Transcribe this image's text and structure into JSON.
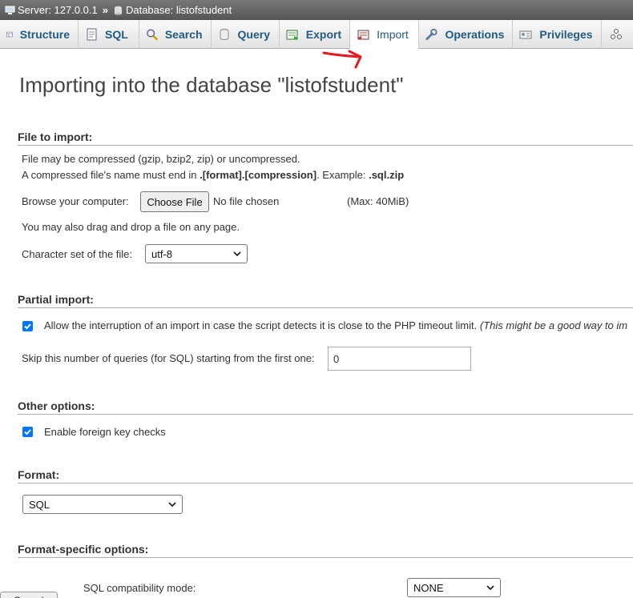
{
  "breadcrumb": {
    "server": "Server: 127.0.0.1",
    "separator": "»",
    "database": "Database: listofstudent"
  },
  "tabs": [
    {
      "label": "Structure",
      "icon": "structure-icon"
    },
    {
      "label": "SQL",
      "icon": "sql-icon"
    },
    {
      "label": "Search",
      "icon": "search-icon"
    },
    {
      "label": "Query",
      "icon": "query-icon"
    },
    {
      "label": "Export",
      "icon": "export-icon"
    },
    {
      "label": "Import",
      "icon": "import-icon",
      "active": true
    },
    {
      "label": "Operations",
      "icon": "wrench-icon"
    },
    {
      "label": "Privileges",
      "icon": "privileges-icon"
    }
  ],
  "title": "Importing into the database \"listofstudent\"",
  "file_to_import": {
    "heading": "File to import:",
    "line1": "File may be compressed (gzip, bzip2, zip) or uncompressed.",
    "line2_prefix": "A compressed file's name must end in ",
    "line2_format": ".[format].[compression]",
    "line2_mid": ". Example: ",
    "line2_example": ".sql.zip",
    "browse_label": "Browse your computer:",
    "choose_file_button": "Choose File",
    "no_file": "No file chosen",
    "max_size": "(Max: 40MiB)",
    "drag_drop": "You may also drag and drop a file on any page.",
    "charset_label": "Character set of the file:",
    "charset_value": "utf-8"
  },
  "partial_import": {
    "heading": "Partial import:",
    "allow_interrupt_label": "Allow the interruption of an import in case the script detects it is close to the PHP timeout limit.",
    "allow_interrupt_note": "(This might be a good way to im",
    "allow_interrupt_checked": true,
    "skip_label": "Skip this number of queries (for SQL) starting from the first one:",
    "skip_value": "0"
  },
  "other_options": {
    "heading": "Other options:",
    "foreign_key_label": "Enable foreign key checks",
    "foreign_key_checked": true
  },
  "format": {
    "heading": "Format:",
    "value": "SQL"
  },
  "format_specific": {
    "heading": "Format-specific options:",
    "compat_label": "SQL compatibility mode:",
    "compat_value": "NONE"
  },
  "cancel_partial": "Cancel",
  "colors": {
    "accent": "#235a81",
    "checkbox": "#0075ff",
    "annotation": "#e02020"
  }
}
